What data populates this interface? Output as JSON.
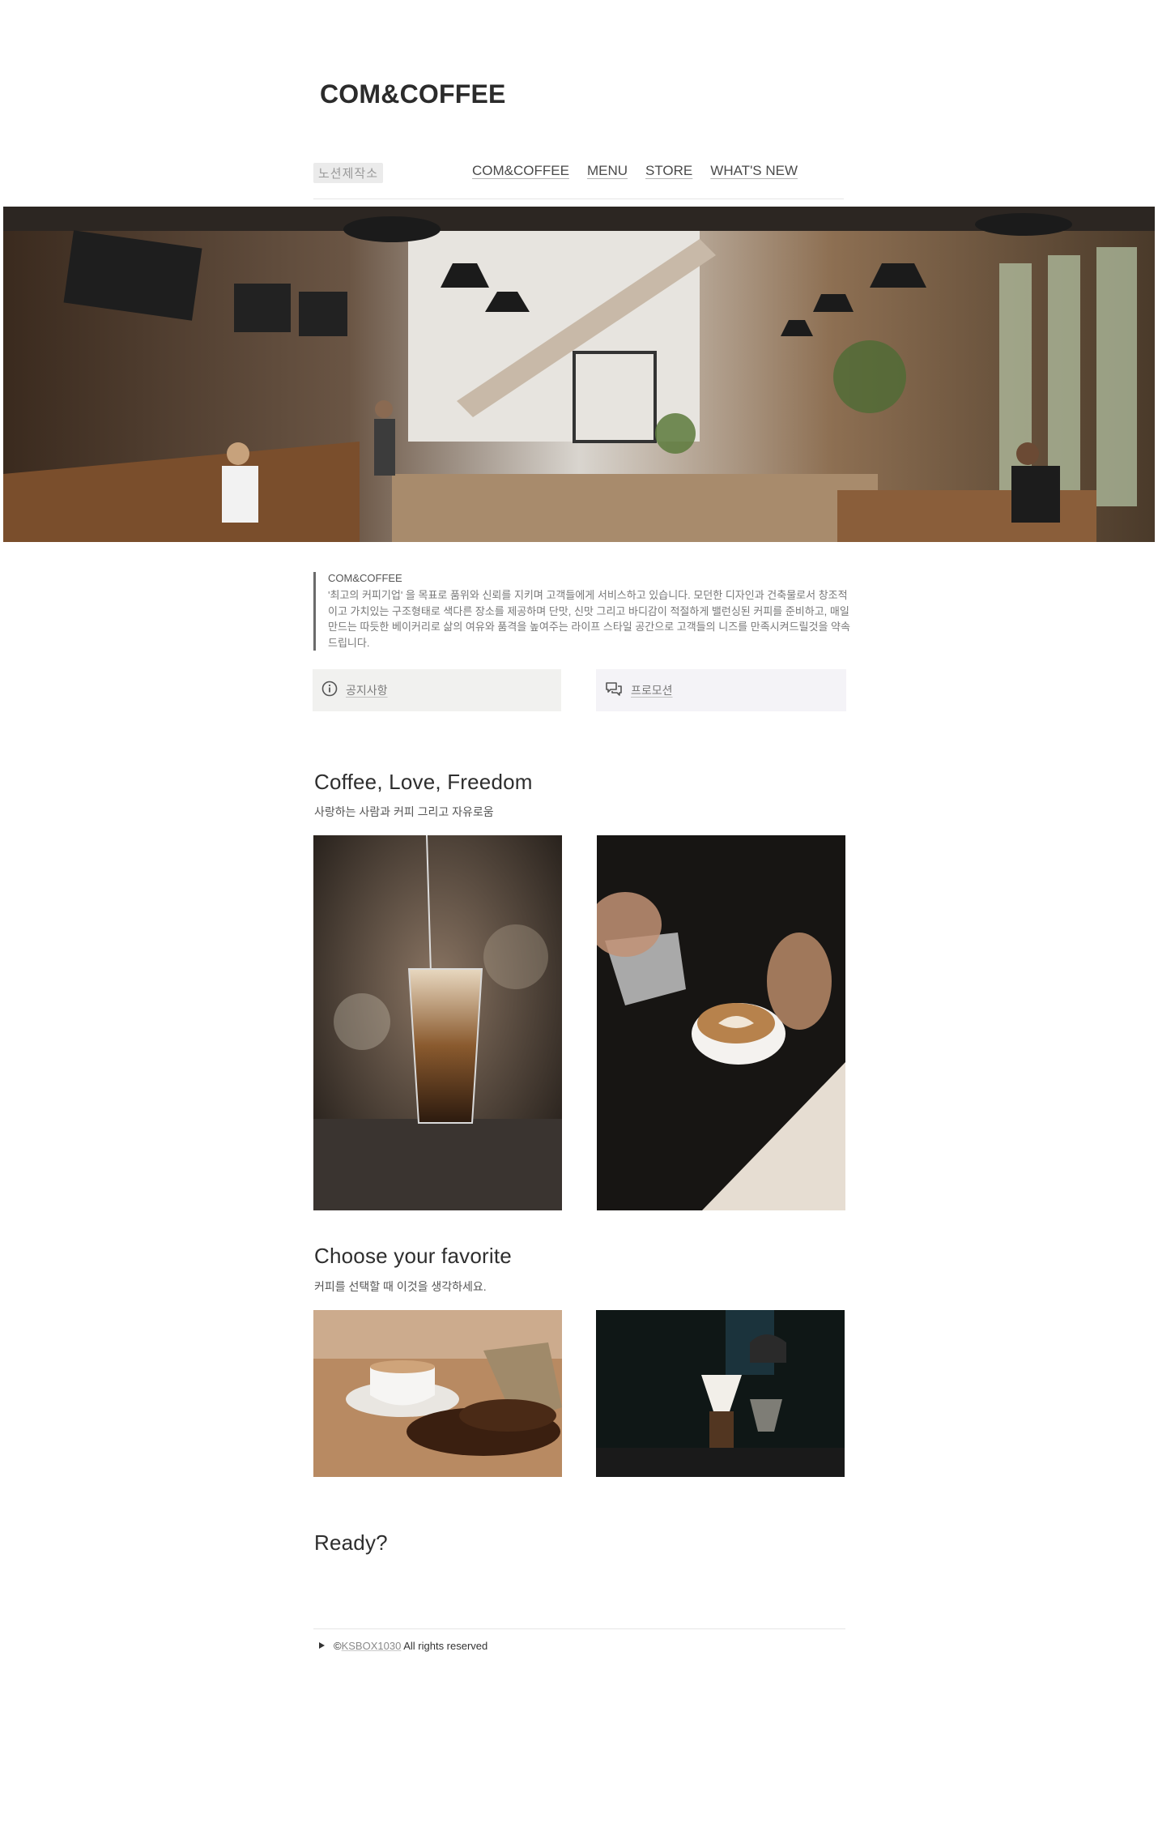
{
  "header": {
    "brand": "COM&COFFEE",
    "nav_logo": "노션제작소",
    "nav": [
      "COM&COFFEE",
      "MENU",
      "STORE",
      "WHAT'S NEW"
    ]
  },
  "intro": {
    "title": "COM&COFFEE",
    "body": "'최고의 커피기업' 을 목표로 품위와 신뢰를 지키며 고객들에게 서비스하고 있습니다. 모던한 디자인과 건축물로서 창조적이고 가치있는 구조형태로 색다른 장소를 제공하며 단맛, 신맛 그리고 바디감이 적절하게 밸런싱된 커피를 준비하고, 매일 만드는 따듯한 베이커리로 삶의 여유와 품격을 높여주는 라이프 스타일 공간으로 고객들의 니즈를 만족시켜드릴것을 약속드립니다."
  },
  "callouts": [
    {
      "icon": "info-icon",
      "label": "공지사항"
    },
    {
      "icon": "chat-bubbles-icon",
      "label": "프로모션"
    }
  ],
  "section1": {
    "title": "Coffee, Love, Freedom",
    "subtitle": "사랑하는 사람과 커피 그리고 자유로움"
  },
  "section2": {
    "title": "Choose your favorite",
    "subtitle": "커피를 선택할 때 이것을 생각하세요."
  },
  "section3": {
    "title": "Ready?"
  },
  "footer": {
    "copyright_symbol": "©",
    "link": "KSBOX1030",
    "rest": "All rights reserved"
  },
  "colors": {
    "text": "#37352f",
    "callout_gray": "#f1f1ef",
    "callout_purple": "#f4f3f7",
    "quote_border": "#6b6b6b"
  }
}
